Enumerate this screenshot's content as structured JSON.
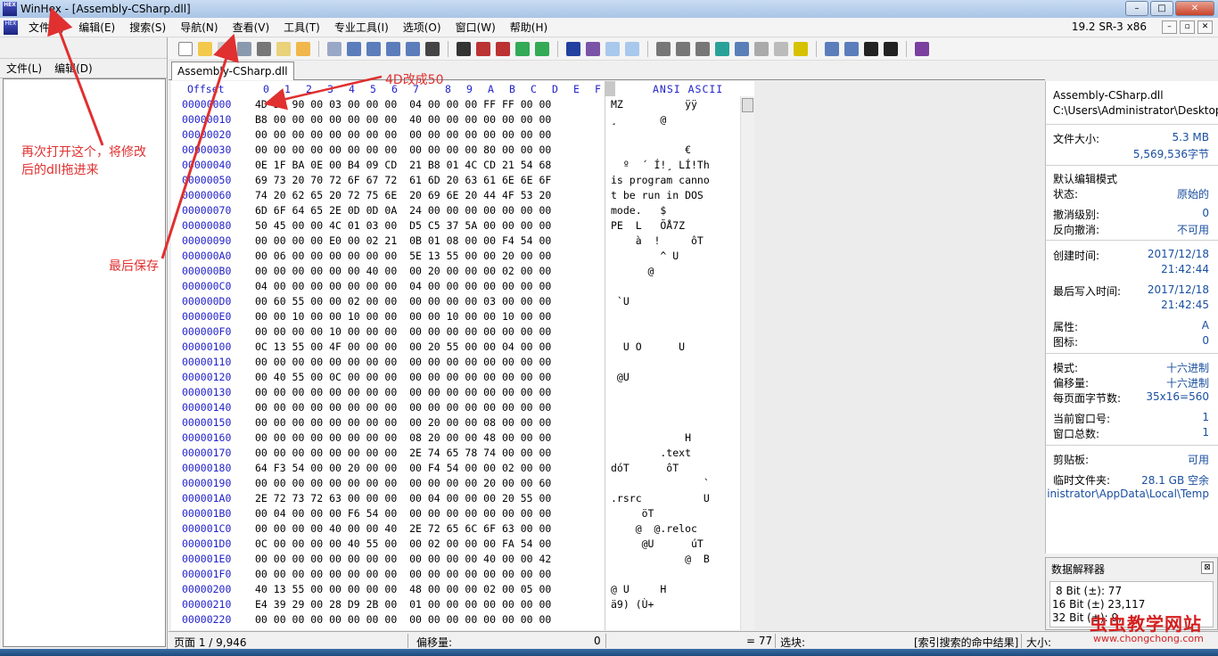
{
  "window": {
    "title": "WinHex - [Assembly-CSharp.dll]",
    "logo_text": "HEX",
    "minimize": "–",
    "maximize": "□",
    "close": "✕"
  },
  "menu": {
    "items": [
      "文件(F)",
      "编辑(E)",
      "搜索(S)",
      "导航(N)",
      "查看(V)",
      "工具(T)",
      "专业工具(I)",
      "选项(O)",
      "窗口(W)",
      "帮助(H)"
    ],
    "version": "19.2 SR-3 x86",
    "mdi_minimize": "–",
    "mdi_restore": "▫",
    "mdi_close": "✕"
  },
  "left_panel": {
    "menu": [
      "文件(L)",
      "编辑(D)"
    ]
  },
  "tab": {
    "label": "Assembly-CSharp.dll"
  },
  "hex": {
    "offset_header": "Offset",
    "columns": [
      "0",
      "1",
      "2",
      "3",
      "4",
      "5",
      "6",
      "7",
      "8",
      "9",
      "A",
      "B",
      "C",
      "D",
      "E",
      "F"
    ],
    "ansi_header": "ANSI ASCII",
    "rows": [
      {
        "off": "00000000",
        "hex": "4D 5A 90 00 03 00 00 00  04 00 00 00 FF FF 00 00",
        "ansi": "MZ          ÿÿ"
      },
      {
        "off": "00000010",
        "hex": "B8 00 00 00 00 00 00 00  40 00 00 00 00 00 00 00",
        "ansi": "¸       @"
      },
      {
        "off": "00000020",
        "hex": "00 00 00 00 00 00 00 00  00 00 00 00 00 00 00 00",
        "ansi": ""
      },
      {
        "off": "00000030",
        "hex": "00 00 00 00 00 00 00 00  00 00 00 00 80 00 00 00",
        "ansi": "            €"
      },
      {
        "off": "00000040",
        "hex": "0E 1F BA 0E 00 B4 09 CD  21 B8 01 4C CD 21 54 68",
        "ansi": "  º  ´ Í!¸ LÍ!Th"
      },
      {
        "off": "00000050",
        "hex": "69 73 20 70 72 6F 67 72  61 6D 20 63 61 6E 6E 6F",
        "ansi": "is program canno"
      },
      {
        "off": "00000060",
        "hex": "74 20 62 65 20 72 75 6E  20 69 6E 20 44 4F 53 20",
        "ansi": "t be run in DOS "
      },
      {
        "off": "00000070",
        "hex": "6D 6F 64 65 2E 0D 0D 0A  24 00 00 00 00 00 00 00",
        "ansi": "mode.   $"
      },
      {
        "off": "00000080",
        "hex": "50 45 00 00 4C 01 03 00  D5 C5 37 5A 00 00 00 00",
        "ansi": "PE  L   ÕÅ7Z"
      },
      {
        "off": "00000090",
        "hex": "00 00 00 00 E0 00 02 21  0B 01 08 00 00 F4 54 00",
        "ansi": "    à  !     ôT"
      },
      {
        "off": "000000A0",
        "hex": "00 06 00 00 00 00 00 00  5E 13 55 00 00 20 00 00",
        "ansi": "        ^ U"
      },
      {
        "off": "000000B0",
        "hex": "00 00 00 00 00 00 40 00  00 20 00 00 00 02 00 00",
        "ansi": "      @"
      },
      {
        "off": "000000C0",
        "hex": "04 00 00 00 00 00 00 00  04 00 00 00 00 00 00 00",
        "ansi": ""
      },
      {
        "off": "000000D0",
        "hex": "00 60 55 00 00 02 00 00  00 00 00 00 03 00 00 00",
        "ansi": " `U"
      },
      {
        "off": "000000E0",
        "hex": "00 00 10 00 00 10 00 00  00 00 10 00 00 10 00 00",
        "ansi": ""
      },
      {
        "off": "000000F0",
        "hex": "00 00 00 00 10 00 00 00  00 00 00 00 00 00 00 00",
        "ansi": ""
      },
      {
        "off": "00000100",
        "hex": "0C 13 55 00 4F 00 00 00  00 20 55 00 00 04 00 00",
        "ansi": "  U O      U"
      },
      {
        "off": "00000110",
        "hex": "00 00 00 00 00 00 00 00  00 00 00 00 00 00 00 00",
        "ansi": ""
      },
      {
        "off": "00000120",
        "hex": "00 40 55 00 0C 00 00 00  00 00 00 00 00 00 00 00",
        "ansi": " @U"
      },
      {
        "off": "00000130",
        "hex": "00 00 00 00 00 00 00 00  00 00 00 00 00 00 00 00",
        "ansi": ""
      },
      {
        "off": "00000140",
        "hex": "00 00 00 00 00 00 00 00  00 00 00 00 00 00 00 00",
        "ansi": ""
      },
      {
        "off": "00000150",
        "hex": "00 00 00 00 00 00 00 00  00 20 00 00 08 00 00 00",
        "ansi": ""
      },
      {
        "off": "00000160",
        "hex": "00 00 00 00 00 00 00 00  08 20 00 00 48 00 00 00",
        "ansi": "            H"
      },
      {
        "off": "00000170",
        "hex": "00 00 00 00 00 00 00 00  2E 74 65 78 74 00 00 00",
        "ansi": "        .text"
      },
      {
        "off": "00000180",
        "hex": "64 F3 54 00 00 20 00 00  00 F4 54 00 00 02 00 00",
        "ansi": "dóT      ôT"
      },
      {
        "off": "00000190",
        "hex": "00 00 00 00 00 00 00 00  00 00 00 00 20 00 00 60",
        "ansi": "               `"
      },
      {
        "off": "000001A0",
        "hex": "2E 72 73 72 63 00 00 00  00 04 00 00 00 20 55 00",
        "ansi": ".rsrc          U"
      },
      {
        "off": "000001B0",
        "hex": "00 04 00 00 00 F6 54 00  00 00 00 00 00 00 00 00",
        "ansi": "     öT"
      },
      {
        "off": "000001C0",
        "hex": "00 00 00 00 40 00 00 40  2E 72 65 6C 6F 63 00 00",
        "ansi": "    @  @.reloc"
      },
      {
        "off": "000001D0",
        "hex": "0C 00 00 00 00 40 55 00  00 02 00 00 00 FA 54 00",
        "ansi": "     @U      úT"
      },
      {
        "off": "000001E0",
        "hex": "00 00 00 00 00 00 00 00  00 00 00 00 40 00 00 42",
        "ansi": "            @  B"
      },
      {
        "off": "000001F0",
        "hex": "00 00 00 00 00 00 00 00  00 00 00 00 00 00 00 00",
        "ansi": ""
      },
      {
        "off": "00000200",
        "hex": "40 13 55 00 00 00 00 00  48 00 00 00 02 00 05 00",
        "ansi": "@ U     H"
      },
      {
        "off": "00000210",
        "hex": "E4 39 29 00 28 D9 2B 00  01 00 00 00 00 00 00 00",
        "ansi": "ä9) (Ù+"
      },
      {
        "off": "00000220",
        "hex": "00 00 00 00 00 00 00 00  00 00 00 00 00 00 00 00",
        "ansi": ""
      }
    ]
  },
  "info": {
    "filename": "Assembly-CSharp.dll",
    "path": "C:\\Users\\Administrator\\Desktop",
    "file_size_label": "文件大小:",
    "file_size_mb": "5.3 MB",
    "file_size_bytes": "5,569,536字节",
    "default_edit_mode": "默认编辑模式",
    "state_label": "状态:",
    "state_value": "原始的",
    "undo_level_label": "撤消级别:",
    "undo_level_value": "0",
    "reverse_undo_label": "反向撤消:",
    "reverse_undo_value": "不可用",
    "created_label": "创建时间:",
    "created_date": "2017/12/18",
    "created_time": "21:42:44",
    "modified_label": "最后写入时间:",
    "modified_date": "2017/12/18",
    "modified_time": "21:42:45",
    "attr_label": "属性:",
    "attr_value": "A",
    "icon_label": "图标:",
    "icon_value": "0",
    "mode_label": "模式:",
    "mode_value": "十六进制",
    "offset_label": "偏移量:",
    "offset_value": "十六进制",
    "bytes_per_page_label": "每页面字节数:",
    "bytes_per_page_value": "35x16=560",
    "cur_window_label": "当前窗口号:",
    "cur_window_value": "1",
    "window_total_label": "窗口总数:",
    "window_total_value": "1",
    "clipboard_label": "剪贴板:",
    "clipboard_value": "可用",
    "temp_label": "临时文件夹:",
    "temp_value": "28.1 GB 空余",
    "temp_path": "inistrator\\AppData\\Local\\Temp"
  },
  "interpreter": {
    "title": "数据解释器",
    "close": "⊠",
    "bit8": "8 Bit (±): 77",
    "bit16": "16 Bit (±) 23,117",
    "bit32": "32 Bit (±): 9,"
  },
  "status": {
    "page": "页面 1 / 9,946",
    "offset_label": "偏移量:",
    "offset_value": "0",
    "equals": "= 77",
    "selection_label": "选块:",
    "search_result": "[索引搜索的命中结果]",
    "size_label": "大小:"
  },
  "annotations": {
    "reopen": "再次打开这个，将修改",
    "reopen2": "后的dll拖进来",
    "save": "最后保存",
    "change": "4D改成50"
  },
  "watermark": {
    "main": "虫虫教学网站",
    "sub": "www.chongchong.com"
  }
}
